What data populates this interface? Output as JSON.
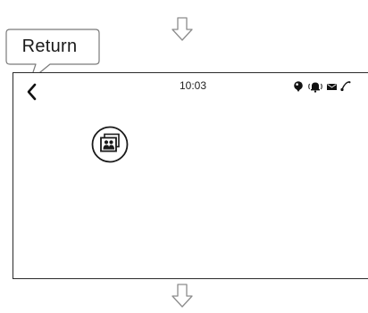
{
  "callout": {
    "label": "Return"
  },
  "status_bar": {
    "time": "10:03",
    "icons": [
      "location-pin-icon",
      "vibrate-bell-icon",
      "message-icon",
      "signal-icon"
    ]
  },
  "screen": {
    "back_icon": "chevron-left-icon",
    "apps": [
      {
        "icon": "photo-album-icon"
      }
    ]
  },
  "navigation_hints": [
    "arrow-down-icon",
    "arrow-down-icon"
  ]
}
